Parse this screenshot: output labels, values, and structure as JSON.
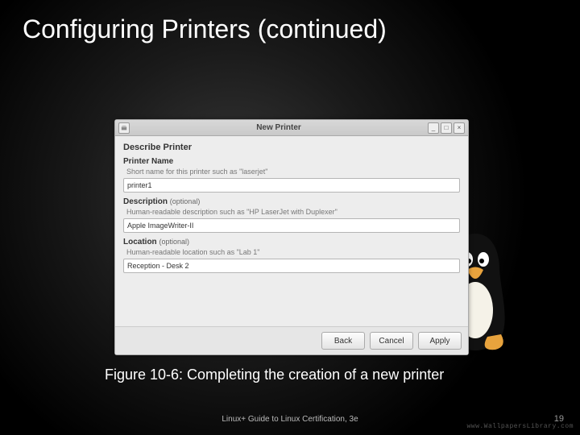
{
  "slide": {
    "title": "Configuring Printers (continued)",
    "caption": "Figure 10-6: Completing the creation of a new printer",
    "footer": "Linux+ Guide to Linux Certification, 3e",
    "page": "19",
    "watermark": "www.WallpapersLibrary.com"
  },
  "window": {
    "title": "New Printer",
    "heading": "Describe Printer",
    "name_label": "Printer Name",
    "name_hint": "Short name for this printer such as \"laserjet\"",
    "name_value": "printer1",
    "desc_label": "Description",
    "optional": "(optional)",
    "desc_hint": "Human-readable description such as \"HP LaserJet with Duplexer\"",
    "desc_value": "Apple ImageWriter-II",
    "loc_label": "Location",
    "loc_hint": "Human-readable location such as \"Lab 1\"",
    "loc_value": "Reception - Desk 2",
    "back": "Back",
    "cancel": "Cancel",
    "apply": "Apply"
  }
}
